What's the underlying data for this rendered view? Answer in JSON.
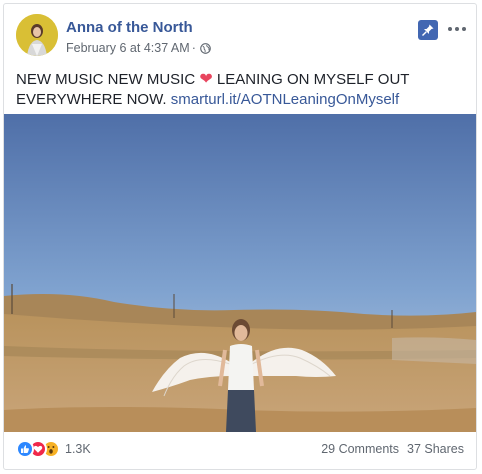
{
  "post": {
    "page_name": "Anna of the North",
    "timestamp": "February 6 at 4:37 AM",
    "separator": "·",
    "text_main": "NEW MUSIC NEW MUSIC",
    "text_after_heart": "LEANING ON MYSELF OUT EVERYWHERE NOW.",
    "link": "smarturl.it/AOTNLeaningOnMyself",
    "heart_glyph": "❤"
  },
  "footer": {
    "reaction_count": "1.3K",
    "comments": "29 Comments",
    "shares": "37 Shares"
  },
  "colors": {
    "link": "#385898",
    "pin_button": "#4267b2",
    "like": "#2d88ff",
    "love": "#f0284a",
    "wow": "#f7b125"
  },
  "icons": [
    "globe-icon",
    "pin-icon",
    "more-options-icon",
    "like-reaction-icon",
    "love-reaction-icon",
    "wow-reaction-icon"
  ]
}
